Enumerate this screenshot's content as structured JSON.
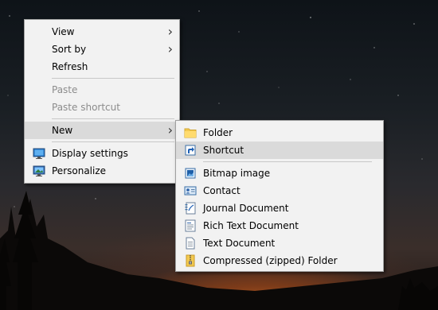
{
  "desktop_menu": {
    "items": [
      {
        "label": "View"
      },
      {
        "label": "Sort by"
      },
      {
        "label": "Refresh"
      },
      {
        "label": "Paste"
      },
      {
        "label": "Paste shortcut"
      },
      {
        "label": "New"
      },
      {
        "label": "Display settings",
        "icon": "display-settings-icon"
      },
      {
        "label": "Personalize",
        "icon": "personalize-icon"
      }
    ]
  },
  "new_submenu": {
    "items": [
      {
        "label": "Folder",
        "icon": "folder-icon"
      },
      {
        "label": "Shortcut",
        "icon": "shortcut-icon"
      },
      {
        "label": "Bitmap image",
        "icon": "bitmap-image-icon"
      },
      {
        "label": "Contact",
        "icon": "contact-icon"
      },
      {
        "label": "Journal Document",
        "icon": "journal-document-icon"
      },
      {
        "label": "Rich Text Document",
        "icon": "rich-text-document-icon"
      },
      {
        "label": "Text Document",
        "icon": "text-document-icon"
      },
      {
        "label": "Compressed (zipped) Folder",
        "icon": "zip-folder-icon"
      }
    ]
  },
  "colors": {
    "menu_background": "#f2f2f2",
    "highlight": "#dadada",
    "disabled_text": "#8c8c8c"
  }
}
